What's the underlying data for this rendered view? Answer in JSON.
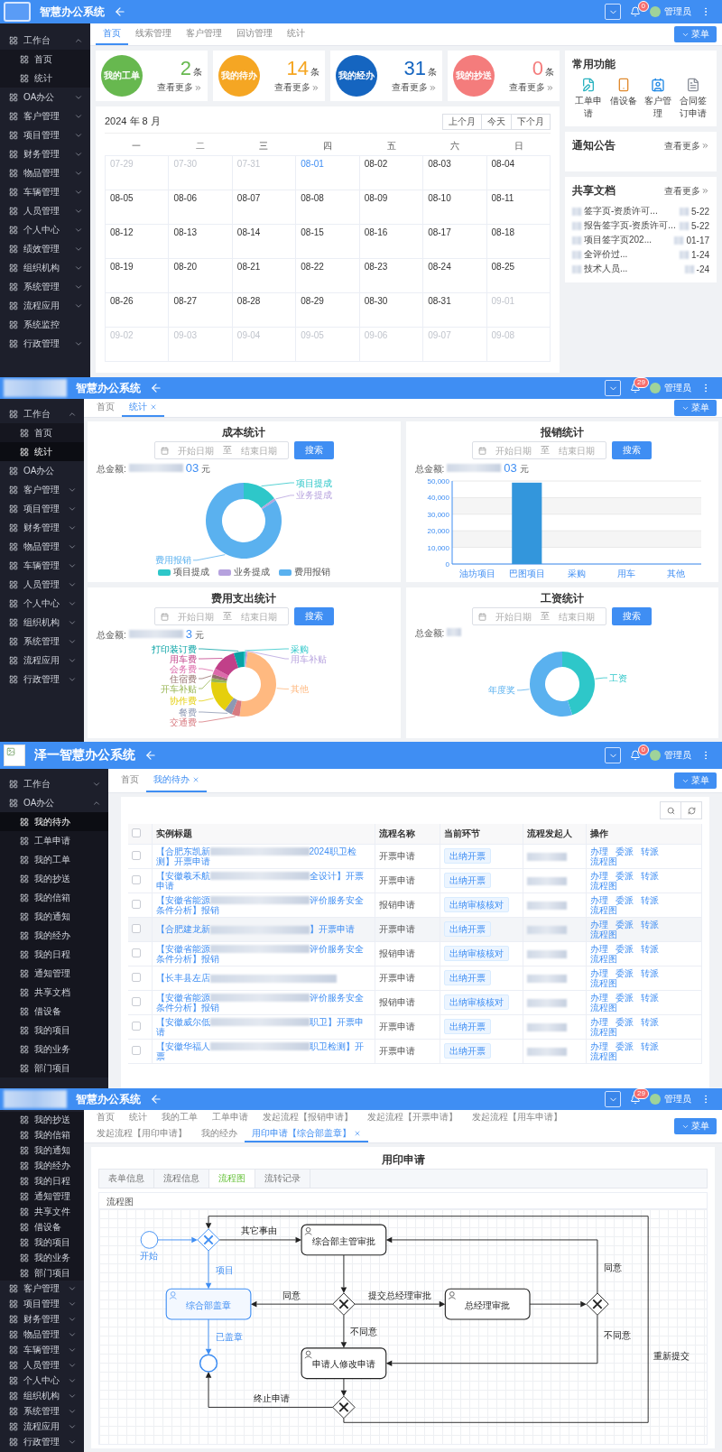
{
  "screens": [
    {
      "kind": "home",
      "header": {
        "kind": "frame",
        "title": "智慧办公系统",
        "badge": "0",
        "user": "管理员"
      },
      "sidebar": {
        "items": [
          {
            "label": "工作台",
            "expanded": true,
            "children": [
              {
                "label": "首页",
                "selected": false
              },
              {
                "label": "统计",
                "selected": false
              }
            ]
          },
          {
            "label": "OA办公",
            "expanded": false
          },
          {
            "label": "客户管理",
            "expanded": false
          },
          {
            "label": "项目管理",
            "expanded": false
          },
          {
            "label": "财务管理",
            "expanded": false
          },
          {
            "label": "物品管理",
            "expanded": false
          },
          {
            "label": "车辆管理",
            "expanded": false
          },
          {
            "label": "人员管理",
            "expanded": false
          },
          {
            "label": "个人中心",
            "expanded": false
          },
          {
            "label": "绩效管理",
            "expanded": false
          },
          {
            "label": "组织机构",
            "expanded": false
          },
          {
            "label": "系统管理",
            "expanded": false
          },
          {
            "label": "流程应用",
            "expanded": false
          },
          {
            "label": "系统监控"
          },
          {
            "label": "行政管理",
            "expanded": false
          }
        ]
      },
      "tabs": [
        {
          "label": "首页",
          "selected": true,
          "closable": false
        },
        {
          "label": "线索管理",
          "selected": false,
          "closable": false
        },
        {
          "label": "客户管理",
          "selected": false,
          "closable": false
        },
        {
          "label": "回访管理",
          "selected": false,
          "closable": false
        },
        {
          "label": "统计",
          "selected": false,
          "closable": false
        }
      ],
      "menu_button": "菜单",
      "stat_cards": [
        {
          "label": "我的工单",
          "count": "2",
          "unit": "条",
          "more": "查看更多",
          "color": "#67b84f"
        },
        {
          "label": "我的待办",
          "count": "14",
          "unit": "条",
          "more": "查看更多",
          "color": "#f5a623"
        },
        {
          "label": "我的经办",
          "count": "31",
          "unit": "条",
          "more": "查看更多",
          "color": "#1565c0"
        },
        {
          "label": "我的抄送",
          "count": "0",
          "unit": "条",
          "more": "查看更多",
          "color": "#f47c7c"
        }
      ],
      "calendar": {
        "title": "2024 年 8 月",
        "nav": [
          "上个月",
          "今天",
          "下个月"
        ],
        "weekdays": [
          "一",
          "二",
          "三",
          "四",
          "五",
          "六",
          "日"
        ],
        "days": [
          {
            "date": "07-29",
            "other_month": true,
            "selected": false
          },
          {
            "date": "07-30",
            "other_month": true,
            "selected": false
          },
          {
            "date": "07-31",
            "other_month": true,
            "selected": false
          },
          {
            "date": "08-01",
            "other_month": false,
            "selected": true
          },
          {
            "date": "08-02",
            "other_month": false,
            "selected": false
          },
          {
            "date": "08-03",
            "other_month": false,
            "selected": false
          },
          {
            "date": "08-04",
            "other_month": false,
            "selected": false
          },
          {
            "date": "08-05",
            "other_month": false,
            "selected": false
          },
          {
            "date": "08-06",
            "other_month": false,
            "selected": false
          },
          {
            "date": "08-07",
            "other_month": false,
            "selected": false
          },
          {
            "date": "08-08",
            "other_month": false,
            "selected": false
          },
          {
            "date": "08-09",
            "other_month": false,
            "selected": false
          },
          {
            "date": "08-10",
            "other_month": false,
            "selected": false
          },
          {
            "date": "08-11",
            "other_month": false,
            "selected": false
          },
          {
            "date": "08-12",
            "other_month": false,
            "selected": false
          },
          {
            "date": "08-13",
            "other_month": false,
            "selected": false
          },
          {
            "date": "08-14",
            "other_month": false,
            "selected": false
          },
          {
            "date": "08-15",
            "other_month": false,
            "selected": false
          },
          {
            "date": "08-16",
            "other_month": false,
            "selected": false
          },
          {
            "date": "08-17",
            "other_month": false,
            "selected": false
          },
          {
            "date": "08-18",
            "other_month": false,
            "selected": false
          },
          {
            "date": "08-19",
            "other_month": false,
            "selected": false
          },
          {
            "date": "08-20",
            "other_month": false,
            "selected": false
          },
          {
            "date": "08-21",
            "other_month": false,
            "selected": false
          },
          {
            "date": "08-22",
            "other_month": false,
            "selected": false
          },
          {
            "date": "08-23",
            "other_month": false,
            "selected": false
          },
          {
            "date": "08-24",
            "other_month": false,
            "selected": false
          },
          {
            "date": "08-25",
            "other_month": false,
            "selected": false
          },
          {
            "date": "08-26",
            "other_month": false,
            "selected": false
          },
          {
            "date": "08-27",
            "other_month": false,
            "selected": false
          },
          {
            "date": "08-28",
            "other_month": false,
            "selected": false
          },
          {
            "date": "08-29",
            "other_month": false,
            "selected": false
          },
          {
            "date": "08-30",
            "other_month": false,
            "selected": false
          },
          {
            "date": "08-31",
            "other_month": false,
            "selected": false
          },
          {
            "date": "09-01",
            "other_month": true,
            "selected": false
          },
          {
            "date": "09-02",
            "other_month": true,
            "selected": false
          },
          {
            "date": "09-03",
            "other_month": true,
            "selected": false
          },
          {
            "date": "09-04",
            "other_month": true,
            "selected": false
          },
          {
            "date": "09-05",
            "other_month": true,
            "selected": false
          },
          {
            "date": "09-06",
            "other_month": true,
            "selected": false
          },
          {
            "date": "09-07",
            "other_month": true,
            "selected": false
          },
          {
            "date": "09-08",
            "other_month": true,
            "selected": false
          }
        ]
      },
      "quick_functions": {
        "title": "常用功能",
        "items": [
          {
            "label": "工单申请"
          },
          {
            "label": "借设备"
          },
          {
            "label": "客户管理"
          },
          {
            "label": "合同签订申请"
          }
        ]
      },
      "notices": {
        "title": "通知公告",
        "more": "查看更多"
      },
      "shared_docs": {
        "title": "共享文档",
        "more": "查看更多",
        "items": [
          {
            "name": "签字页-资质许可...",
            "date": "5-22"
          },
          {
            "name": "报告签字页-资质许可...",
            "date": "5-22"
          },
          {
            "name": "项目签字页202...",
            "date": "01-17"
          },
          {
            "name": "全评价过...",
            "date": "1-24"
          },
          {
            "name": "技术人员...",
            "date": "-24"
          }
        ]
      }
    },
    {
      "kind": "statistics",
      "header": {
        "kind": "blurred",
        "title": "智慧办公系统",
        "badge": "29",
        "user": "管理员"
      },
      "sidebar": {
        "items": [
          {
            "label": "工作台",
            "expanded": true,
            "children": [
              {
                "label": "首页",
                "selected": false
              },
              {
                "label": "统计",
                "selected": true
              }
            ]
          },
          {
            "label": "OA办公"
          },
          {
            "label": "客户管理",
            "expanded": false
          },
          {
            "label": "项目管理",
            "expanded": false
          },
          {
            "label": "财务管理",
            "expanded": false
          },
          {
            "label": "物品管理",
            "expanded": false
          },
          {
            "label": "车辆管理",
            "expanded": false
          },
          {
            "label": "人员管理",
            "expanded": false
          },
          {
            "label": "个人中心",
            "expanded": false
          },
          {
            "label": "组织机构",
            "expanded": false
          },
          {
            "label": "系统管理",
            "expanded": false
          },
          {
            "label": "流程应用",
            "expanded": false
          },
          {
            "label": "行政管理",
            "expanded": false
          }
        ]
      },
      "tabs": [
        {
          "label": "首页",
          "selected": false,
          "closable": false
        },
        {
          "label": "统计",
          "selected": true,
          "closable": true
        }
      ],
      "menu_button": "菜单",
      "cards": [
        {
          "kind": "donut",
          "title": "成本统计",
          "start_placeholder": "开始日期",
          "separator": "至",
          "end_placeholder": "结束日期",
          "search": "搜索",
          "total_label": "总金额:",
          "amount_tail": "03",
          "currency": "元",
          "slices": [
            {
              "label": "项目提成",
              "color": "#2ec7c9"
            },
            {
              "label": "业务提成",
              "color": "#b6a2de"
            },
            {
              "label": "费用报销",
              "color": "#5ab1ef"
            }
          ],
          "legend": [
            {
              "label": "项目提成",
              "color": "#2ec7c9"
            },
            {
              "label": "业务提成",
              "color": "#b6a2de"
            },
            {
              "label": "费用报销",
              "color": "#5ab1ef"
            }
          ]
        },
        {
          "kind": "bar",
          "title": "报销统计",
          "start_placeholder": "开始日期",
          "separator": "至",
          "end_placeholder": "结束日期",
          "search": "搜索",
          "total_label": "总金额:",
          "amount_tail": "03",
          "currency": "元",
          "chart_data": {
            "type": "bar",
            "grid": true,
            "categories": [
              "油坊项目",
              "巴图项目",
              "采购",
              "用车",
              "其他"
            ],
            "values": [
              0,
              49000,
              0,
              0,
              0
            ],
            "ylim": [
              0,
              50000
            ],
            "yticks": [
              {
                "value": 0,
                "label": "0"
              },
              {
                "value": 10000,
                "label": "10,000"
              },
              {
                "value": 20000,
                "label": "20,000"
              },
              {
                "value": 30000,
                "label": "30,000"
              },
              {
                "value": 40000,
                "label": "40,000"
              },
              {
                "value": 50000,
                "label": "50,000"
              }
            ]
          }
        },
        {
          "kind": "donut",
          "title": "费用支出统计",
          "start_placeholder": "开始日期",
          "separator": "至",
          "end_placeholder": "结束日期",
          "search": "搜索",
          "total_label": "总金额:",
          "amount_tail": "3",
          "currency": "元",
          "slices": [
            {
              "label": "采购",
              "color": "#2ec7c9"
            },
            {
              "label": "用车补贴",
              "color": "#b6a2de"
            },
            {
              "label": "其他",
              "color": "#ffb980"
            },
            {
              "label": "打印装订费",
              "color": "#07a2a4"
            },
            {
              "label": "用车费",
              "color": "#c14089"
            },
            {
              "label": "会务费",
              "color": "#dc69aa"
            },
            {
              "label": "住宿费",
              "color": "#95706d"
            },
            {
              "label": "开车补贴",
              "color": "#97b552"
            },
            {
              "label": "协作费",
              "color": "#e5cf0d"
            },
            {
              "label": "餐费",
              "color": "#8d98b3"
            },
            {
              "label": "交通费",
              "color": "#d87a80"
            }
          ]
        },
        {
          "kind": "donut",
          "title": "工资统计",
          "start_placeholder": "开始日期",
          "separator": "至",
          "end_placeholder": "结束日期",
          "search": "搜索",
          "total_label": "总金额:",
          "slices": [
            {
              "label": "工资",
              "color": "#2ec7c9"
            },
            {
              "label": "年度奖",
              "color": "#5ab1ef"
            }
          ]
        }
      ]
    },
    {
      "kind": "todo",
      "header": {
        "kind": "broken",
        "title": "泽一智慧办公系统",
        "badge": "0",
        "user": "管理员"
      },
      "sidebar": {
        "items": [
          {
            "label": "工作台",
            "expanded": false
          },
          {
            "label": "OA办公",
            "expanded": true,
            "children": [
              {
                "label": "我的待办",
                "selected": true
              },
              {
                "label": "工单申请",
                "selected": false
              },
              {
                "label": "我的工单",
                "selected": false
              },
              {
                "label": "我的抄送",
                "selected": false
              },
              {
                "label": "我的信箱",
                "selected": false
              },
              {
                "label": "我的通知",
                "selected": false
              },
              {
                "label": "我的经办",
                "selected": false
              },
              {
                "label": "我的日程",
                "selected": false
              },
              {
                "label": "通知管理",
                "selected": false
              },
              {
                "label": "共享文档",
                "selected": false
              },
              {
                "label": "借设备",
                "selected": false
              },
              {
                "label": "我的项目",
                "selected": false
              },
              {
                "label": "我的业务",
                "selected": false
              },
              {
                "label": "部门项目",
                "selected": false
              }
            ]
          }
        ]
      },
      "tabs": [
        {
          "label": "首页",
          "selected": false,
          "closable": false
        },
        {
          "label": "我的待办",
          "selected": true,
          "closable": true
        }
      ],
      "menu_button": "菜单",
      "table": {
        "columns": [
          "实例标题",
          "流程名称",
          "当前环节",
          "流程发起人",
          "操作"
        ],
        "header_checked": false,
        "rows": [
          {
            "title_start": "【合肥东凯新",
            "title_end": "2024职卫检测】开票申请",
            "process": "开票申请",
            "step": "出纳开票",
            "checked": false,
            "highlighted": false,
            "actions": [
              "办理",
              "委派",
              "转派",
              "流程图"
            ]
          },
          {
            "title_start": "【安徽羲禾航",
            "title_end": "全设计】开票申请",
            "process": "开票申请",
            "step": "出纳开票",
            "checked": false,
            "highlighted": false,
            "actions": [
              "办理",
              "委派",
              "转派",
              "流程图"
            ]
          },
          {
            "title_start": "【安徽省能源",
            "title_end": "评价服务安全条件分析】报销",
            "process": "报销申请",
            "step": "出纳审核核对",
            "checked": false,
            "highlighted": false,
            "actions": [
              "办理",
              "委派",
              "转派",
              "流程图"
            ]
          },
          {
            "title_start": "【合肥建龙新",
            "title_end": "】开票申请",
            "process": "开票申请",
            "step": "出纳开票",
            "checked": false,
            "highlighted": true,
            "actions": [
              "办理",
              "委派",
              "转派",
              "流程图"
            ]
          },
          {
            "title_start": "【安徽省能源",
            "title_end": "评价服务安全条件分析】报销",
            "process": "报销申请",
            "step": "出纳审核核对",
            "checked": false,
            "highlighted": false,
            "actions": [
              "办理",
              "委派",
              "转派",
              "流程图"
            ]
          },
          {
            "title_start": "【长丰县左店",
            "title_end": "",
            "process": "开票申请",
            "step": "出纳开票",
            "checked": false,
            "highlighted": false,
            "actions": [
              "办理",
              "委派",
              "转派",
              "流程图"
            ]
          },
          {
            "title_start": "【安徽省能源",
            "title_end": "评价服务安全条件分析】报销",
            "process": "报销申请",
            "step": "出纳审核核对",
            "checked": false,
            "highlighted": false,
            "actions": [
              "办理",
              "委派",
              "转派",
              "流程图"
            ]
          },
          {
            "title_start": "【安徽威尔低",
            "title_end": "职卫】开票申请",
            "process": "开票申请",
            "step": "出纳开票",
            "checked": false,
            "highlighted": false,
            "actions": [
              "办理",
              "委派",
              "转派",
              "流程图"
            ]
          },
          {
            "title_start": "【安徽华福人",
            "title_end": "职卫检测】开票",
            "process": "开票申请",
            "step": "出纳开票",
            "checked": false,
            "highlighted": false,
            "actions": [
              "办理",
              "委派",
              "转派",
              "流程图"
            ]
          }
        ]
      }
    },
    {
      "kind": "process",
      "header": {
        "kind": "blurred",
        "title": "智慧办公系统",
        "badge": "29",
        "user": "管理员"
      },
      "sidebar": {
        "items": [
          {
            "expanded": true,
            "children": [
              {
                "label": "我的抄送",
                "selected": false
              },
              {
                "label": "我的信箱",
                "selected": false
              },
              {
                "label": "我的通知",
                "selected": false
              },
              {
                "label": "我的经办",
                "selected": false
              },
              {
                "label": "我的日程",
                "selected": false
              },
              {
                "label": "通知管理",
                "selected": false
              },
              {
                "label": "共享文件",
                "selected": false
              },
              {
                "label": "借设备",
                "selected": false
              },
              {
                "label": "我的项目",
                "selected": false
              },
              {
                "label": "我的业务",
                "selected": false
              },
              {
                "label": "部门项目",
                "selected": false
              }
            ]
          },
          {
            "label": "客户管理",
            "expanded": false
          },
          {
            "label": "项目管理",
            "expanded": false
          },
          {
            "label": "财务管理",
            "expanded": false
          },
          {
            "label": "物品管理",
            "expanded": false
          },
          {
            "label": "车辆管理",
            "expanded": false
          },
          {
            "label": "人员管理",
            "expanded": false
          },
          {
            "label": "个人中心",
            "expanded": false
          },
          {
            "label": "组织机构",
            "expanded": false
          },
          {
            "label": "系统管理",
            "expanded": false
          },
          {
            "label": "流程应用",
            "expanded": false
          },
          {
            "label": "行政管理",
            "expanded": false
          }
        ]
      },
      "tabs": [
        {
          "label": "首页",
          "selected": false,
          "closable": false
        },
        {
          "label": "统计",
          "selected": false,
          "closable": false
        },
        {
          "label": "我的工单",
          "selected": false,
          "closable": false
        },
        {
          "label": "工单申请",
          "selected": false,
          "closable": false
        },
        {
          "label": "发起流程【报销申请】",
          "selected": false,
          "closable": false
        },
        {
          "label": "发起流程【开票申请】",
          "selected": false,
          "closable": false
        },
        {
          "label": "发起流程【用车申请】",
          "selected": false,
          "closable": false
        },
        {
          "label": "发起流程【用印申请】",
          "selected": false,
          "closable": false
        },
        {
          "label": "我的经办",
          "selected": false,
          "closable": false
        },
        {
          "label": "用印申请【综合部盖章】",
          "selected": true,
          "closable": true
        }
      ],
      "menu_button": "菜单",
      "page_title": "用印申请",
      "sub_tabs": [
        {
          "label": "表单信息",
          "selected": false
        },
        {
          "label": "流程信息",
          "selected": false
        },
        {
          "label": "流程图",
          "selected": true
        },
        {
          "label": "流转记录",
          "selected": false
        }
      ],
      "diagram": {
        "title": "流程图",
        "nodes": [
          {
            "kind": "start",
            "label": "开始",
            "active": true
          },
          {
            "kind": "gateway",
            "active": true
          },
          {
            "kind": "task",
            "label": "综合部主管审批",
            "active": false
          },
          {
            "kind": "task",
            "label": "综合部盖章",
            "active": true
          },
          {
            "kind": "gateway",
            "active": false
          },
          {
            "kind": "task",
            "label": "总经理审批",
            "active": false
          },
          {
            "kind": "gateway",
            "active": false
          },
          {
            "kind": "end",
            "active": true
          },
          {
            "kind": "task",
            "label": "申请人修改申请",
            "active": false
          },
          {
            "kind": "gateway",
            "active": false
          }
        ],
        "edges": [
          {
            "active": true
          },
          {
            "label": "其它事由",
            "active": false
          },
          {
            "label": "项目",
            "active": true
          },
          {
            "active": false
          },
          {
            "label": "同意",
            "active": false
          },
          {
            "label": "提交总经理审批",
            "active": false
          },
          {
            "active": false
          },
          {
            "label": "同意",
            "active": false
          },
          {
            "label": "不同意",
            "active": false
          },
          {
            "label": "不同意",
            "active": false
          },
          {
            "label": "已盖章",
            "active": true
          },
          {
            "active": false
          },
          {
            "label": "终止申请",
            "active": false
          },
          {
            "label": "重新提交",
            "active": false
          }
        ]
      }
    }
  ]
}
